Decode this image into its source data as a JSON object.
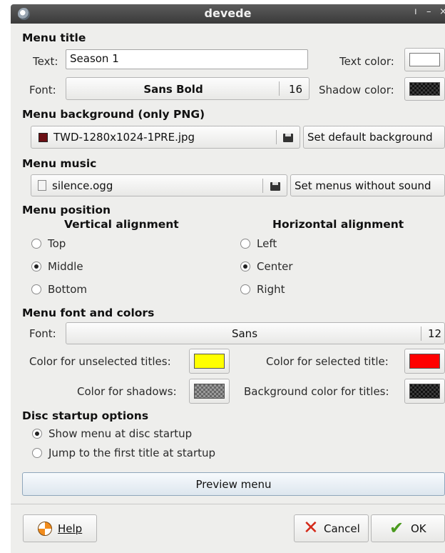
{
  "window": {
    "title": "devede"
  },
  "menu_title": {
    "heading": "Menu title",
    "text_label": "Text:",
    "text_value": "Season 1",
    "text_color_label": "Text color:",
    "font_label": "Font:",
    "font_name": "Sans Bold",
    "font_size": "16",
    "shadow_color_label": "Shadow color:",
    "text_color": "#ffffff",
    "shadow_color": "#000000"
  },
  "menu_background": {
    "heading": "Menu background (only PNG)",
    "file": "TWD-1280x1024-1PRE.jpg",
    "default_button": "Set default background"
  },
  "menu_music": {
    "heading": "Menu music",
    "file": "silence.ogg",
    "no_sound_button": "Set menus without sound"
  },
  "menu_position": {
    "heading": "Menu position",
    "vertical_label": "Vertical alignment",
    "horizontal_label": "Horizontal alignment",
    "vertical_options": [
      "Top",
      "Middle",
      "Bottom"
    ],
    "vertical_selected": "Middle",
    "horizontal_options": [
      "Left",
      "Center",
      "Right"
    ],
    "horizontal_selected": "Center"
  },
  "font_colors": {
    "heading": "Menu font and colors",
    "font_label": "Font:",
    "font_name": "Sans",
    "font_size": "12",
    "unselected_label": "Color for unselected titles:",
    "selected_label": "Color for selected title:",
    "shadows_label": "Color for shadows:",
    "bg_titles_label": "Background color for titles:",
    "unselected_color": "#ffff00",
    "selected_color": "#ff0000"
  },
  "disc_startup": {
    "heading": "Disc startup options",
    "options": [
      "Show menu at disc startup",
      "Jump to the first title at startup"
    ],
    "selected": "Show menu at disc startup"
  },
  "preview_button": "Preview menu",
  "footer": {
    "help": "Help",
    "cancel": "Cancel",
    "ok": "OK"
  }
}
